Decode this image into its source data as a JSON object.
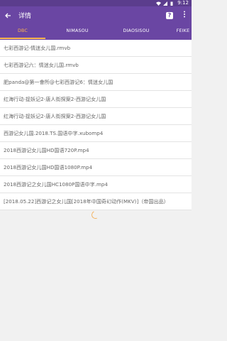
{
  "status_bar": {
    "time": "9:12"
  },
  "app_bar": {
    "title": "详情",
    "help_label": "?"
  },
  "tabs": [
    {
      "label": "DBC"
    },
    {
      "label": "NIMASOU"
    },
    {
      "label": "DIAOSISOU"
    },
    {
      "label": "FEIKE"
    }
  ],
  "results": [
    "七彩西游记-情迷女儿国.rmvb",
    "七彩西游记六：情迷女儿国.rmvb",
    "肥panda@第一會所@七彩西游记6：情迷女儿国",
    "红海行动-捉妖记2-唐人街探案2-西游记女儿国",
    "红海行动-捉妖记2-唐人街探案2-西游记女儿国",
    "西游记女儿国.2018.TS.国语中字.xubomp4",
    "2018西游记女儿国HD国语720P.mp4",
    "2018西游记女儿国HD国语1080P.mp4",
    "2018西游记之女儿国HC1080P国语中字.mp4",
    "[2018.05.22]西游记之女儿国[2018年中国奇幻动作(MKV)]（帝国出品）"
  ],
  "colors": {
    "primary": "#6a46a3",
    "status": "#5b3d8d",
    "accent": "#ffb74d"
  },
  "icons": {
    "back": "arrow-left-icon",
    "help": "help-icon",
    "more": "more-vert-icon",
    "wifi": "wifi-icon",
    "signal": "signal-icon",
    "battery": "battery-icon",
    "loading": "loading-spinner"
  }
}
